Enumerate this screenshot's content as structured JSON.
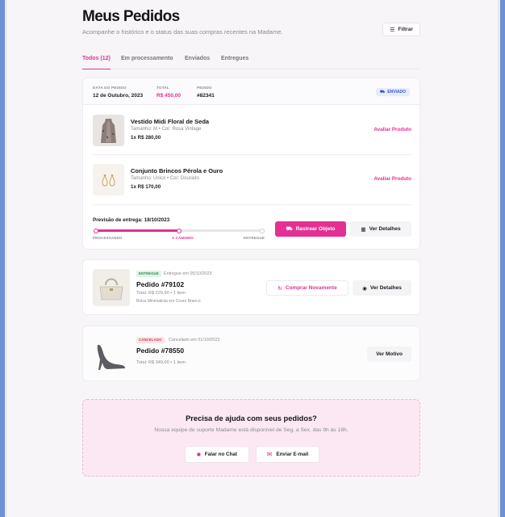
{
  "header": {
    "title": "Meus Pedidos",
    "subtitle": "Acompanhe o histórico e o status das suas compras recentes na Madame.",
    "filter_label": "Filtrar"
  },
  "tabs": [
    {
      "label": "Todos (12)",
      "active": true
    },
    {
      "label": "Em processamento",
      "active": false
    },
    {
      "label": "Enviados",
      "active": false
    },
    {
      "label": "Entregues",
      "active": false
    }
  ],
  "orders": {
    "current": {
      "date_label": "DATA DO PEDIDO",
      "date": "12 de Outubro, 2023",
      "total_label": "TOTAL",
      "total": "R$ 450,00",
      "order_label": "PEDIDO",
      "order_no": "#82341",
      "status": "ENVIADO",
      "items": [
        {
          "name": "Vestido Midi Floral de Seda",
          "details": "Tamanho: M • Cor: Rosa Vintage",
          "price": "1x R$ 280,00",
          "action": "Avaliar Produto"
        },
        {
          "name": "Conjunto Brincos Pérola e Ouro",
          "details": "Tamanho: Único • Cor: Dourado",
          "price": "1x R$ 170,00",
          "action": "Avaliar Produto"
        }
      ],
      "forecast": "Previsão de entrega: 18/10/2023",
      "steps": [
        "PROCESSANDO",
        "A CAMINHO",
        "ENTREGUE"
      ],
      "progress": 0.5,
      "track_button": "Rastrear Objeto",
      "details_button": "Ver Detalhes"
    },
    "delivered": {
      "badge": "ENTREGUE",
      "badge_date": "Entregue em 05/10/2023",
      "order_no": "Pedido #79102",
      "summary": "Total: R$ 229,90 • 1 item",
      "description": "Bolsa Minimalista em Couro Branco",
      "rebuy_button": "Comprar Novamente",
      "details_button": "Ver Detalhes"
    },
    "cancelled": {
      "badge": "CANCELADO",
      "badge_date": "Cancelado em 01/10/2023",
      "order_no": "Pedido #78550",
      "summary": "Total: R$ 349,00 • 1 item",
      "reason_button": "Ver Motivo"
    }
  },
  "help": {
    "title": "Precisa de ajuda com seus pedidos?",
    "subtitle": "Nossa equipe de suporte Madame está disponível de Seg. a Sex. das 9h às 18h.",
    "chat_button": "Falar no Chat",
    "email_button": "Enviar E-mail"
  },
  "colors": {
    "accent": "#e33092",
    "shipped_bg": "#e6ecfb",
    "delivered_bg": "#dff3e5",
    "cancelled_bg": "#fbe3e6"
  }
}
